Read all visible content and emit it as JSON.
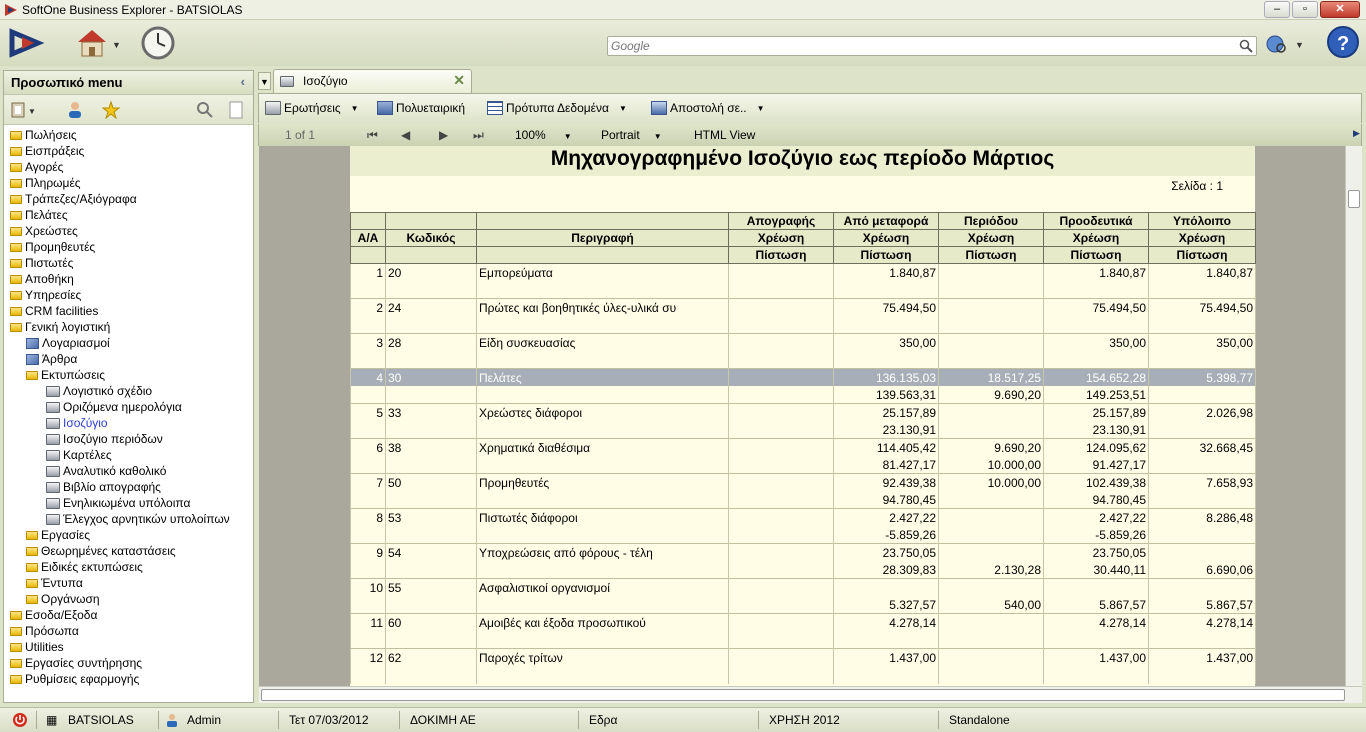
{
  "window": {
    "title": "SoftOne Business Explorer - BATSIOLAS"
  },
  "search": {
    "placeholder": "Google"
  },
  "sidebar": {
    "title": "Προσωπικό menu",
    "items": [
      {
        "label": "Πωλήσεις",
        "level": 0,
        "icon": "folder-icon"
      },
      {
        "label": "Εισπράξεις",
        "level": 0,
        "icon": "folder-icon"
      },
      {
        "label": "Αγορές",
        "level": 0,
        "icon": "folder-icon"
      },
      {
        "label": "Πληρωμές",
        "level": 0,
        "icon": "folder-icon"
      },
      {
        "label": "Τράπεζες/Αξιόγραφα",
        "level": 0,
        "icon": "folder-icon"
      },
      {
        "label": "Πελάτες",
        "level": 0,
        "icon": "folder-icon"
      },
      {
        "label": "Χρεώστες",
        "level": 0,
        "icon": "folder-icon"
      },
      {
        "label": "Προμηθευτές",
        "level": 0,
        "icon": "folder-icon"
      },
      {
        "label": "Πιστωτές",
        "level": 0,
        "icon": "folder-icon"
      },
      {
        "label": "Αποθήκη",
        "level": 0,
        "icon": "folder-icon"
      },
      {
        "label": "Υπηρεσίες",
        "level": 0,
        "icon": "folder-icon"
      },
      {
        "label": "CRM facilities",
        "level": 0,
        "icon": "folder-icon"
      },
      {
        "label": "Γενική λογιστική",
        "level": 0,
        "icon": "folder-open-icon"
      },
      {
        "label": "Λογαριασμοί",
        "level": 1,
        "icon": "cube-icon"
      },
      {
        "label": "Άρθρα",
        "level": 1,
        "icon": "cube-icon"
      },
      {
        "label": "Εκτυπώσεις",
        "level": 1,
        "icon": "folder-open-icon"
      },
      {
        "label": "Λογιστικό σχέδιο",
        "level": 2,
        "icon": "printer-icon"
      },
      {
        "label": "Οριζόμενα ημερολόγια",
        "level": 2,
        "icon": "printer-icon"
      },
      {
        "label": "Ισοζύγιο",
        "level": 2,
        "icon": "printer-icon",
        "active": true
      },
      {
        "label": "Ισοζύγιο περιόδων",
        "level": 2,
        "icon": "printer-icon"
      },
      {
        "label": "Καρτέλες",
        "level": 2,
        "icon": "printer-icon"
      },
      {
        "label": "Αναλυτικό καθολικό",
        "level": 2,
        "icon": "printer-icon"
      },
      {
        "label": "Βιβλίο απογραφής",
        "level": 2,
        "icon": "printer-icon"
      },
      {
        "label": "Ενηλικιωμένα υπόλοιπα",
        "level": 2,
        "icon": "printer-icon"
      },
      {
        "label": "Έλεγχος αρνητικών υπολοίπων",
        "level": 2,
        "icon": "printer-icon"
      },
      {
        "label": "Εργασίες",
        "level": 1,
        "icon": "folder-icon"
      },
      {
        "label": "Θεωρημένες καταστάσεις",
        "level": 1,
        "icon": "folder-icon"
      },
      {
        "label": "Ειδικές εκτυπώσεις",
        "level": 1,
        "icon": "folder-icon"
      },
      {
        "label": "Έντυπα",
        "level": 1,
        "icon": "folder-icon"
      },
      {
        "label": "Οργάνωση",
        "level": 1,
        "icon": "folder-icon"
      },
      {
        "label": "Εσοδα/Εξοδα",
        "level": 0,
        "icon": "folder-icon"
      },
      {
        "label": "Πρόσωπα",
        "level": 0,
        "icon": "folder-icon"
      },
      {
        "label": "Utilities",
        "level": 0,
        "icon": "folder-icon"
      },
      {
        "label": "Εργασίες συντήρησης",
        "level": 0,
        "icon": "folder-icon"
      },
      {
        "label": "Ρυθμίσεις εφαρμογής",
        "level": 0,
        "icon": "folder-icon"
      }
    ]
  },
  "tab": {
    "label": "Ισοζύγιο"
  },
  "commands": {
    "queries": "Ερωτήσεις",
    "multicompany": "Πολυεταιρική",
    "data_templates": "Πρότυπα Δεδομένα",
    "send": "Αποστολή σε.."
  },
  "navbar": {
    "page": "1 of 1",
    "zoom": "100%",
    "orientation": "Portrait",
    "view": "HTML View"
  },
  "report": {
    "title": "Μηχανογραφημένο Ισοζύγιο εως περίοδο  Μάρτιος",
    "page_label": "Σελίδα : 1",
    "headers": {
      "row1": [
        "",
        "",
        "",
        "Απογραφής",
        "Από μεταφορά",
        "Περιόδου",
        "Προοδευτικά",
        "Υπόλοιπο"
      ],
      "row2": [
        "Α/Α",
        "Κωδικός",
        "Περιγραφή",
        "Χρέωση",
        "Χρέωση",
        "Χρέωση",
        "Χρέωση",
        "Χρέωση"
      ],
      "row3": [
        "",
        "",
        "",
        "Πίστωση",
        "Πίστωση",
        "Πίστωση",
        "Πίστωση",
        "Πίστωση"
      ]
    },
    "rows": [
      {
        "aa": "1",
        "code": "20",
        "desc": "Εμπορεύματα",
        "inv_d": "",
        "trans_d": "1.840,87",
        "per_d": "",
        "prog_d": "1.840,87",
        "bal_d": "1.840,87",
        "inv_c": "",
        "trans_c": "",
        "per_c": "",
        "prog_c": "",
        "bal_c": ""
      },
      {
        "aa": "2",
        "code": "24",
        "desc": "Πρώτες και βοηθητικές ύλες-υλικά συ",
        "inv_d": "",
        "trans_d": "75.494,50",
        "per_d": "",
        "prog_d": "75.494,50",
        "bal_d": "75.494,50",
        "inv_c": "",
        "trans_c": "",
        "per_c": "",
        "prog_c": "",
        "bal_c": ""
      },
      {
        "aa": "3",
        "code": "28",
        "desc": "Είδη συσκευασίας",
        "inv_d": "",
        "trans_d": "350,00",
        "per_d": "",
        "prog_d": "350,00",
        "bal_d": "350,00",
        "inv_c": "",
        "trans_c": "",
        "per_c": "",
        "prog_c": "",
        "bal_c": ""
      },
      {
        "aa": "4",
        "code": "30",
        "desc": "Πελάτες",
        "inv_d": "",
        "trans_d": "136.135,03",
        "per_d": "18.517,25",
        "prog_d": "154.652,28",
        "bal_d": "5.398,77",
        "inv_c": "",
        "trans_c": "139.563,31",
        "per_c": "9.690,20",
        "prog_c": "149.253,51",
        "bal_c": "",
        "selected": true
      },
      {
        "aa": "5",
        "code": "33",
        "desc": "Χρεώστες διάφοροι",
        "inv_d": "",
        "trans_d": "25.157,89",
        "per_d": "",
        "prog_d": "25.157,89",
        "bal_d": "2.026,98",
        "inv_c": "",
        "trans_c": "23.130,91",
        "per_c": "",
        "prog_c": "23.130,91",
        "bal_c": ""
      },
      {
        "aa": "6",
        "code": "38",
        "desc": "Χρηματικά διαθέσιμα",
        "inv_d": "",
        "trans_d": "114.405,42",
        "per_d": "9.690,20",
        "prog_d": "124.095,62",
        "bal_d": "32.668,45",
        "inv_c": "",
        "trans_c": "81.427,17",
        "per_c": "10.000,00",
        "prog_c": "91.427,17",
        "bal_c": ""
      },
      {
        "aa": "7",
        "code": "50",
        "desc": "Προμηθευτές",
        "inv_d": "",
        "trans_d": "92.439,38",
        "per_d": "10.000,00",
        "prog_d": "102.439,38",
        "bal_d": "7.658,93",
        "inv_c": "",
        "trans_c": "94.780,45",
        "per_c": "",
        "prog_c": "94.780,45",
        "bal_c": ""
      },
      {
        "aa": "8",
        "code": "53",
        "desc": "Πιστωτές διάφοροι",
        "inv_d": "",
        "trans_d": "2.427,22",
        "per_d": "",
        "prog_d": "2.427,22",
        "bal_d": "8.286,48",
        "inv_c": "",
        "trans_c": "-5.859,26",
        "per_c": "",
        "prog_c": "-5.859,26",
        "bal_c": ""
      },
      {
        "aa": "9",
        "code": "54",
        "desc": "Υποχρεώσεις από φόρους - τέλη",
        "inv_d": "",
        "trans_d": "23.750,05",
        "per_d": "",
        "prog_d": "23.750,05",
        "bal_d": "",
        "inv_c": "",
        "trans_c": "28.309,83",
        "per_c": "2.130,28",
        "prog_c": "30.440,11",
        "bal_c": "6.690,06"
      },
      {
        "aa": "10",
        "code": "55",
        "desc": "Ασφαλιστικοί οργανισμοί",
        "inv_d": "",
        "trans_d": "",
        "per_d": "",
        "prog_d": "",
        "bal_d": "",
        "inv_c": "",
        "trans_c": "5.327,57",
        "per_c": "540,00",
        "prog_c": "5.867,57",
        "bal_c": "5.867,57"
      },
      {
        "aa": "11",
        "code": "60",
        "desc": "Αμοιβές και έξοδα προσωπικού",
        "inv_d": "",
        "trans_d": "4.278,14",
        "per_d": "",
        "prog_d": "4.278,14",
        "bal_d": "4.278,14",
        "inv_c": "",
        "trans_c": "",
        "per_c": "",
        "prog_c": "",
        "bal_c": ""
      },
      {
        "aa": "12",
        "code": "62",
        "desc": "Παροχές τρίτων",
        "inv_d": "",
        "trans_d": "1.437,00",
        "per_d": "",
        "prog_d": "1.437,00",
        "bal_d": "1.437,00",
        "inv_c": "",
        "trans_c": "",
        "per_c": "",
        "prog_c": "",
        "bal_c": ""
      }
    ]
  },
  "statusbar": {
    "user_company": "BATSIOLAS",
    "user": "Admin",
    "date": "Τετ 07/03/2012",
    "company": "ΔΟΚΙΜΗ ΑΕ",
    "branch": "Εδρα",
    "fiscal_year": "ΧΡΗΣΗ 2012",
    "mode": "Standalone"
  }
}
